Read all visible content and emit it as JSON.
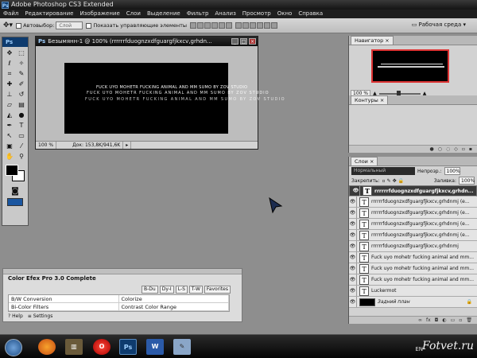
{
  "app": {
    "title": "Adobe Photoshop CS3 Extended",
    "ps_label": "Ps"
  },
  "menu": [
    "Файл",
    "Редактирование",
    "Изображение",
    "Слои",
    "Выделение",
    "Фильтр",
    "Анализ",
    "Просмотр",
    "Окно",
    "Справка"
  ],
  "options": {
    "autoselect_label": "Автовыбор:",
    "autoselect_value": "Слой",
    "show_controls_label": "Показать управляющие элементы",
    "workspace_label": "Рабочая среда"
  },
  "document": {
    "title": "Безымянн-1 @ 100% (rrrrrrfduognzxdfguargfjkxcv,grhdn...",
    "zoom": "100 %",
    "doc_size": "Док: 153,8K/941,6K",
    "canvas_lines": [
      "FUCK UYO MOHETR FUCKING ANIMAL AND MM SUMO BY ZOV STUDIO",
      "FUCK UYO MOHETR FUCKING ANIMAL AND MM SUMO BY ZOV STUDIO",
      "FUCK UYO MOHETR FUCKING ANIMAL AND MM SUMO BY ZOV STUDIO"
    ]
  },
  "navigator": {
    "tab": "Навигатор",
    "zoom": "100 %"
  },
  "paths": {
    "tab": "Контуры"
  },
  "layers": {
    "tab": "Слои",
    "blend_mode": "Нормальный",
    "opacity_label": "Непрозр.:",
    "opacity": "100%",
    "lock_label": "Закрепить:",
    "fill_label": "Заливка:",
    "fill": "100%",
    "items": [
      {
        "name": "rrrrrrfduognzxdfguargfjkxcv,grhdn...",
        "fx": "",
        "selected": true
      },
      {
        "name": "rrrrrrfduognzxdfguargfjkxcv,grhdnmj (e...",
        "fx": ""
      },
      {
        "name": "rrrrrrfduognzxdfguargfjkxcv,grhdnmj (e...",
        "fx": ""
      },
      {
        "name": "rrrrrrfduognzxdfguargfjkxcv,grhdnmj (e...",
        "fx": ""
      },
      {
        "name": "rrrrrrfduognzxdfguargfjkxcv,grhdnmj (e...",
        "fx": ""
      },
      {
        "name": "rrrrrrfduognzxdfguargfjkxcv,grhdnmj",
        "fx": ""
      },
      {
        "name": "Fuck uyo mohetr fucking animal and mm...",
        "fx": ""
      },
      {
        "name": "Fuck uyo mohetr fucking animal and mm...",
        "fx": ""
      },
      {
        "name": "Fuck uyo mohetr fucking animal and mm...",
        "fx": ""
      },
      {
        "name": "Luckermot",
        "fx": ""
      }
    ],
    "background": "Задний план"
  },
  "color_efex": {
    "title": "Color Efex Pro 3.0 Complete",
    "tabs": [
      "B-Du",
      "Dy-I",
      "L-S",
      "T-W",
      "Favorites"
    ],
    "rows": [
      [
        "B/W Conversion",
        "Colorize"
      ],
      [
        "Bi-Color Filters",
        "Contrast Color Range"
      ]
    ],
    "footer": [
      "Help",
      "Settings"
    ]
  },
  "taskbar": {
    "lang": "EN",
    "watermark": "Fotvet.ru",
    "ps_btn": "Ps",
    "word_btn": "W"
  }
}
